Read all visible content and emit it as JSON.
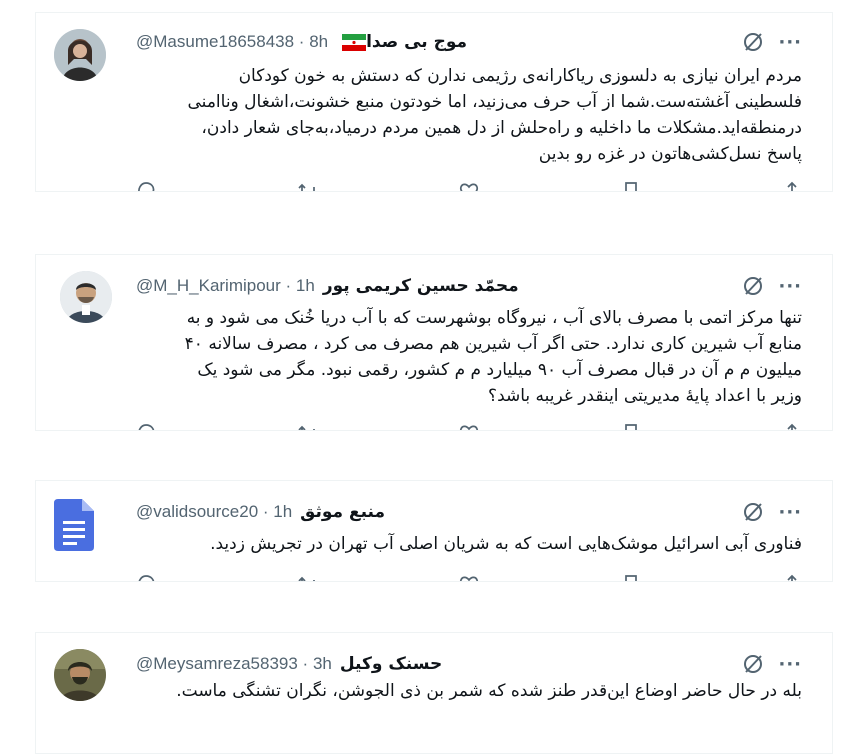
{
  "tweets": [
    {
      "name": "موج بی صدا",
      "handle": "@Masume18658438 · 8h",
      "text": "مردم ایران نیازی به دلسوزی ریاکارانه‌ی رژیمی ندارن که دستش به خون کودکان\nفلسطینی آغشته‌ست.شما از آب حرف می‌زنید، اما خودتون منبع خشونت،اشغال وناامنی\nدرمنطقه‌اید.مشکلات ما داخلیه و راه‌حلش از دل همین مردم درمیاد،به‌جای شعار دادن،\nپاسخ نسل‌کشی‌هاتون در غزه رو بدین",
      "flag": "iran-flag"
    },
    {
      "name": "محمّد حسین کریمی پور",
      "handle": "@M_H_Karimipour · 1h",
      "text": "تنها مرکز اتمی با مصرف بالای آب ، نیروگاه بوشهرست که با آب دریا خُنک می شود و به\nمنابع آب شیرین کاری ندارد. حتی اگر آب شیرین هم مصرف می کرد ، مصرف سالانه ۴۰\nمیلیون م م آن در قبال مصرف آب ۹۰ میلیارد م م کشور، رقمی نبود.  مگر می شود یک\nوزیر با اعداد پایهٔ مدیریتی اینقدر غریبه باشد؟"
    },
    {
      "name": "منبع موثق",
      "handle": "@validsource20 · 1h",
      "text": "فناوری آبی اسرائیل موشک‌هایی است که به شریان اصلی آب تهران در تجریش زدید."
    },
    {
      "name": "حسنک وکیل",
      "handle": "@Meysamreza58393 · 3h",
      "text": "بله در حال حاضر اوضاع این‌قدر طنز شده که شمر بن ذی الجوشن، نگران تشنگی ماست."
    }
  ],
  "icons": {
    "grok": "grok-icon",
    "more": "···",
    "reply": "reply-icon",
    "retweet": "retweet-icon",
    "like": "like-icon",
    "bookmark": "bookmark-icon",
    "share": "share-icon"
  }
}
